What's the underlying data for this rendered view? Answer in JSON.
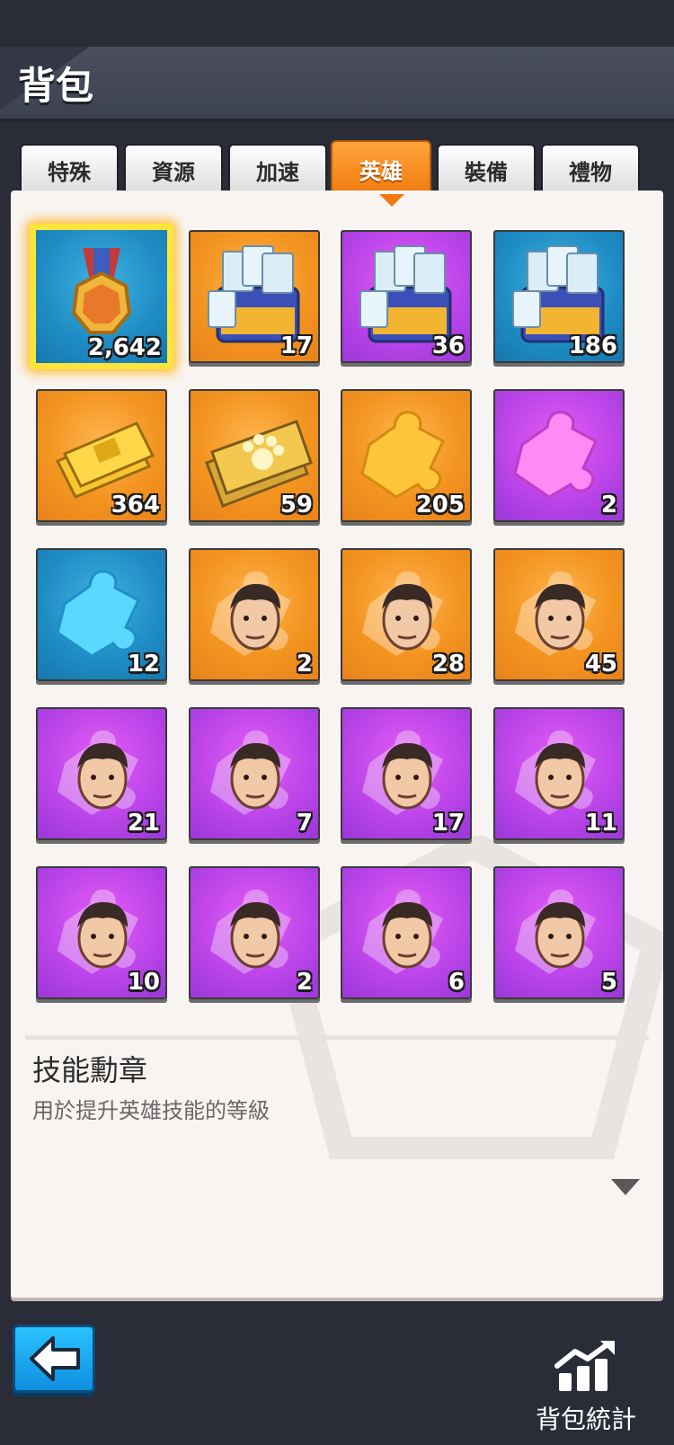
{
  "header": {
    "title": "背包"
  },
  "tabs": [
    {
      "label": "特殊",
      "active": false
    },
    {
      "label": "資源",
      "active": false
    },
    {
      "label": "加速",
      "active": false
    },
    {
      "label": "英雄",
      "active": true
    },
    {
      "label": "裝備",
      "active": false
    },
    {
      "label": "禮物",
      "active": false
    }
  ],
  "items": [
    {
      "name": "skill-medal",
      "color": "blue",
      "icon": "medal-icon",
      "count": "2,642",
      "selected": true
    },
    {
      "name": "exp-chest-orange",
      "color": "orange",
      "icon": "exp-chest-icon",
      "count": "17"
    },
    {
      "name": "exp-chest-purple",
      "color": "purple",
      "icon": "exp-chest-icon",
      "count": "36"
    },
    {
      "name": "exp-chest-blue",
      "color": "blue",
      "icon": "exp-chest-icon",
      "count": "186"
    },
    {
      "name": "gold-ticket",
      "color": "orange",
      "icon": "gold-ticket-icon",
      "count": "364"
    },
    {
      "name": "paw-ticket",
      "color": "orange",
      "icon": "paw-ticket-icon",
      "count": "59"
    },
    {
      "name": "puzzle-gold",
      "color": "orange",
      "icon": "puzzle-gold-icon",
      "count": "205"
    },
    {
      "name": "puzzle-pink",
      "color": "purple",
      "icon": "puzzle-pink-icon",
      "count": "2"
    },
    {
      "name": "puzzle-blue",
      "color": "blue",
      "icon": "puzzle-blue-icon",
      "count": "12"
    },
    {
      "name": "hero-shard-1",
      "color": "orange",
      "icon": "hero-portrait-icon",
      "count": "2"
    },
    {
      "name": "hero-shard-2",
      "color": "orange",
      "icon": "hero-portrait-icon",
      "count": "28"
    },
    {
      "name": "hero-shard-3",
      "color": "orange",
      "icon": "hero-portrait-icon",
      "count": "45"
    },
    {
      "name": "hero-shard-4",
      "color": "purple",
      "icon": "hero-portrait-icon",
      "count": "21"
    },
    {
      "name": "hero-shard-5",
      "color": "purple",
      "icon": "hero-portrait-icon",
      "count": "7"
    },
    {
      "name": "hero-shard-6",
      "color": "purple",
      "icon": "hero-portrait-icon",
      "count": "17"
    },
    {
      "name": "hero-shard-7",
      "color": "purple",
      "icon": "hero-portrait-icon",
      "count": "11"
    },
    {
      "name": "hero-shard-8",
      "color": "purple",
      "icon": "hero-portrait-icon",
      "count": "10"
    },
    {
      "name": "hero-shard-9",
      "color": "purple",
      "icon": "hero-portrait-icon",
      "count": "2"
    },
    {
      "name": "hero-shard-10",
      "color": "purple",
      "icon": "hero-portrait-icon",
      "count": "6"
    },
    {
      "name": "hero-shard-11",
      "color": "purple",
      "icon": "hero-portrait-icon",
      "count": "5"
    }
  ],
  "detail": {
    "title": "技能勳章",
    "description": "用於提升英雄技能的等級"
  },
  "footer": {
    "back_icon": "back-arrow-icon",
    "stats_label": "背包統計",
    "stats_icon": "stats-chart-icon"
  },
  "colors": {
    "orange": "#f39420",
    "purple": "#bd45ea",
    "blue": "#1e8cc4",
    "active_tab": "#f07a0e",
    "selection": "#ffe43a"
  }
}
